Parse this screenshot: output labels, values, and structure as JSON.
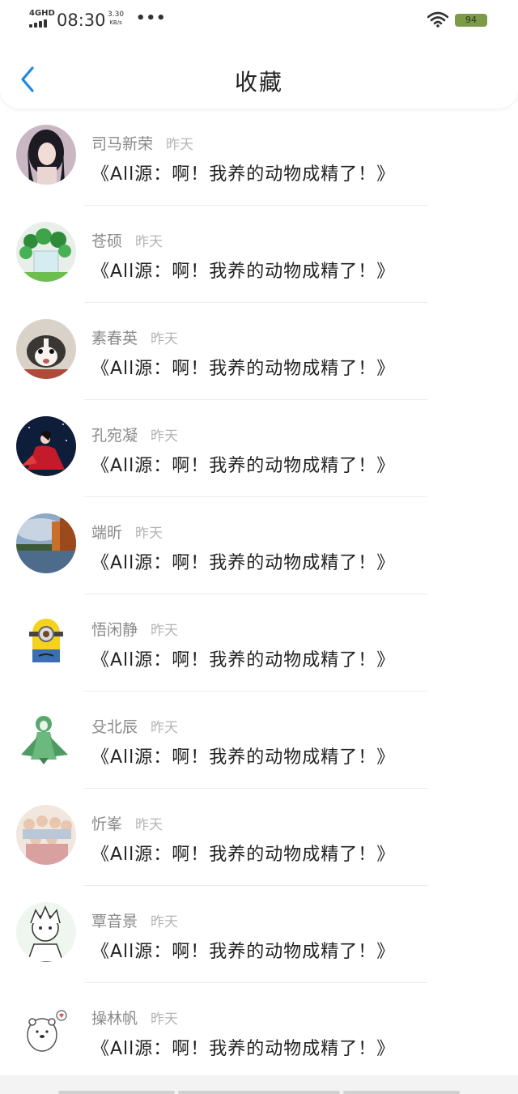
{
  "status_bar": {
    "network": "4GHD",
    "time": "08:30",
    "speed_value": "3.30",
    "speed_unit": "KB/s",
    "dots": "•••",
    "battery": "94"
  },
  "header": {
    "title": "收藏",
    "back_icon": "chevron-left-icon"
  },
  "favorites": [
    {
      "name": "司马新荣",
      "time": "昨天",
      "title": "《All源：啊！我养的动物成精了！》",
      "avatar": "girl-portrait"
    },
    {
      "name": "苍硕",
      "time": "昨天",
      "title": "《All源：啊！我养的动物成精了！》",
      "avatar": "plant-glass"
    },
    {
      "name": "素春英",
      "time": "昨天",
      "title": "《All源：啊！我养的动物成精了！》",
      "avatar": "husky-puppy"
    },
    {
      "name": "孔宛凝",
      "time": "昨天",
      "title": "《All源：啊！我养的动物成精了！》",
      "avatar": "red-dress-woman"
    },
    {
      "name": "端昕",
      "time": "昨天",
      "title": "《All源：啊！我养的动物成精了！》",
      "avatar": "autumn-lake"
    },
    {
      "name": "悟闲静",
      "time": "昨天",
      "title": "《All源：啊！我养的动物成精了！》",
      "avatar": "minion"
    },
    {
      "name": "殳北辰",
      "time": "昨天",
      "title": "《All源：啊！我养的动物成精了！》",
      "avatar": "green-creature"
    },
    {
      "name": "忻峯",
      "time": "昨天",
      "title": "《All源：啊！我养的动物成精了！》",
      "avatar": "group-photo"
    },
    {
      "name": "覃音景",
      "time": "昨天",
      "title": "《All源：啊！我养的动物成精了！》",
      "avatar": "anime-sketch"
    },
    {
      "name": "操林帆",
      "time": "昨天",
      "title": "《All源：啊！我养的动物成精了！》",
      "avatar": "bear-doodle"
    }
  ],
  "colors": {
    "accent": "#1e88e5",
    "name_text": "#8a8a8a",
    "time_text": "#b4b4b4",
    "battery": "#7d9a4a"
  }
}
